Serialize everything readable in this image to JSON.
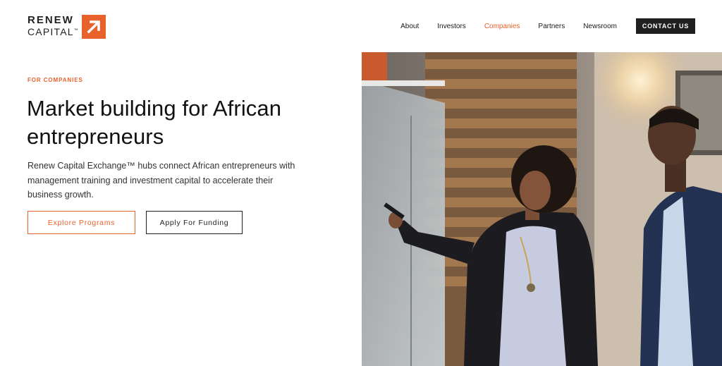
{
  "brand": {
    "line1": "RENEW",
    "line2": "CAPITAL",
    "trademark": "™",
    "accent_color": "#e8622c",
    "icon": "arrow-up-right-icon"
  },
  "nav": {
    "items": [
      {
        "label": "About",
        "active": false
      },
      {
        "label": "Investors",
        "active": false
      },
      {
        "label": "Companies",
        "active": true
      },
      {
        "label": "Partners",
        "active": false
      },
      {
        "label": "Newsroom",
        "active": false
      }
    ],
    "contact_label": "CONTACT US"
  },
  "hero": {
    "eyebrow": "FOR COMPANIES",
    "headline_line1": "Market building for African",
    "headline_line2": "entrepreneurs",
    "description": "Renew Capital Exchange™ hubs connect African entrepreneurs with management training and investment capital to accelerate their business growth.",
    "primary_button": "Explore Programs",
    "secondary_button": "Apply For Funding"
  },
  "colors": {
    "accent": "#e8622c",
    "dark": "#1f1f1f"
  }
}
